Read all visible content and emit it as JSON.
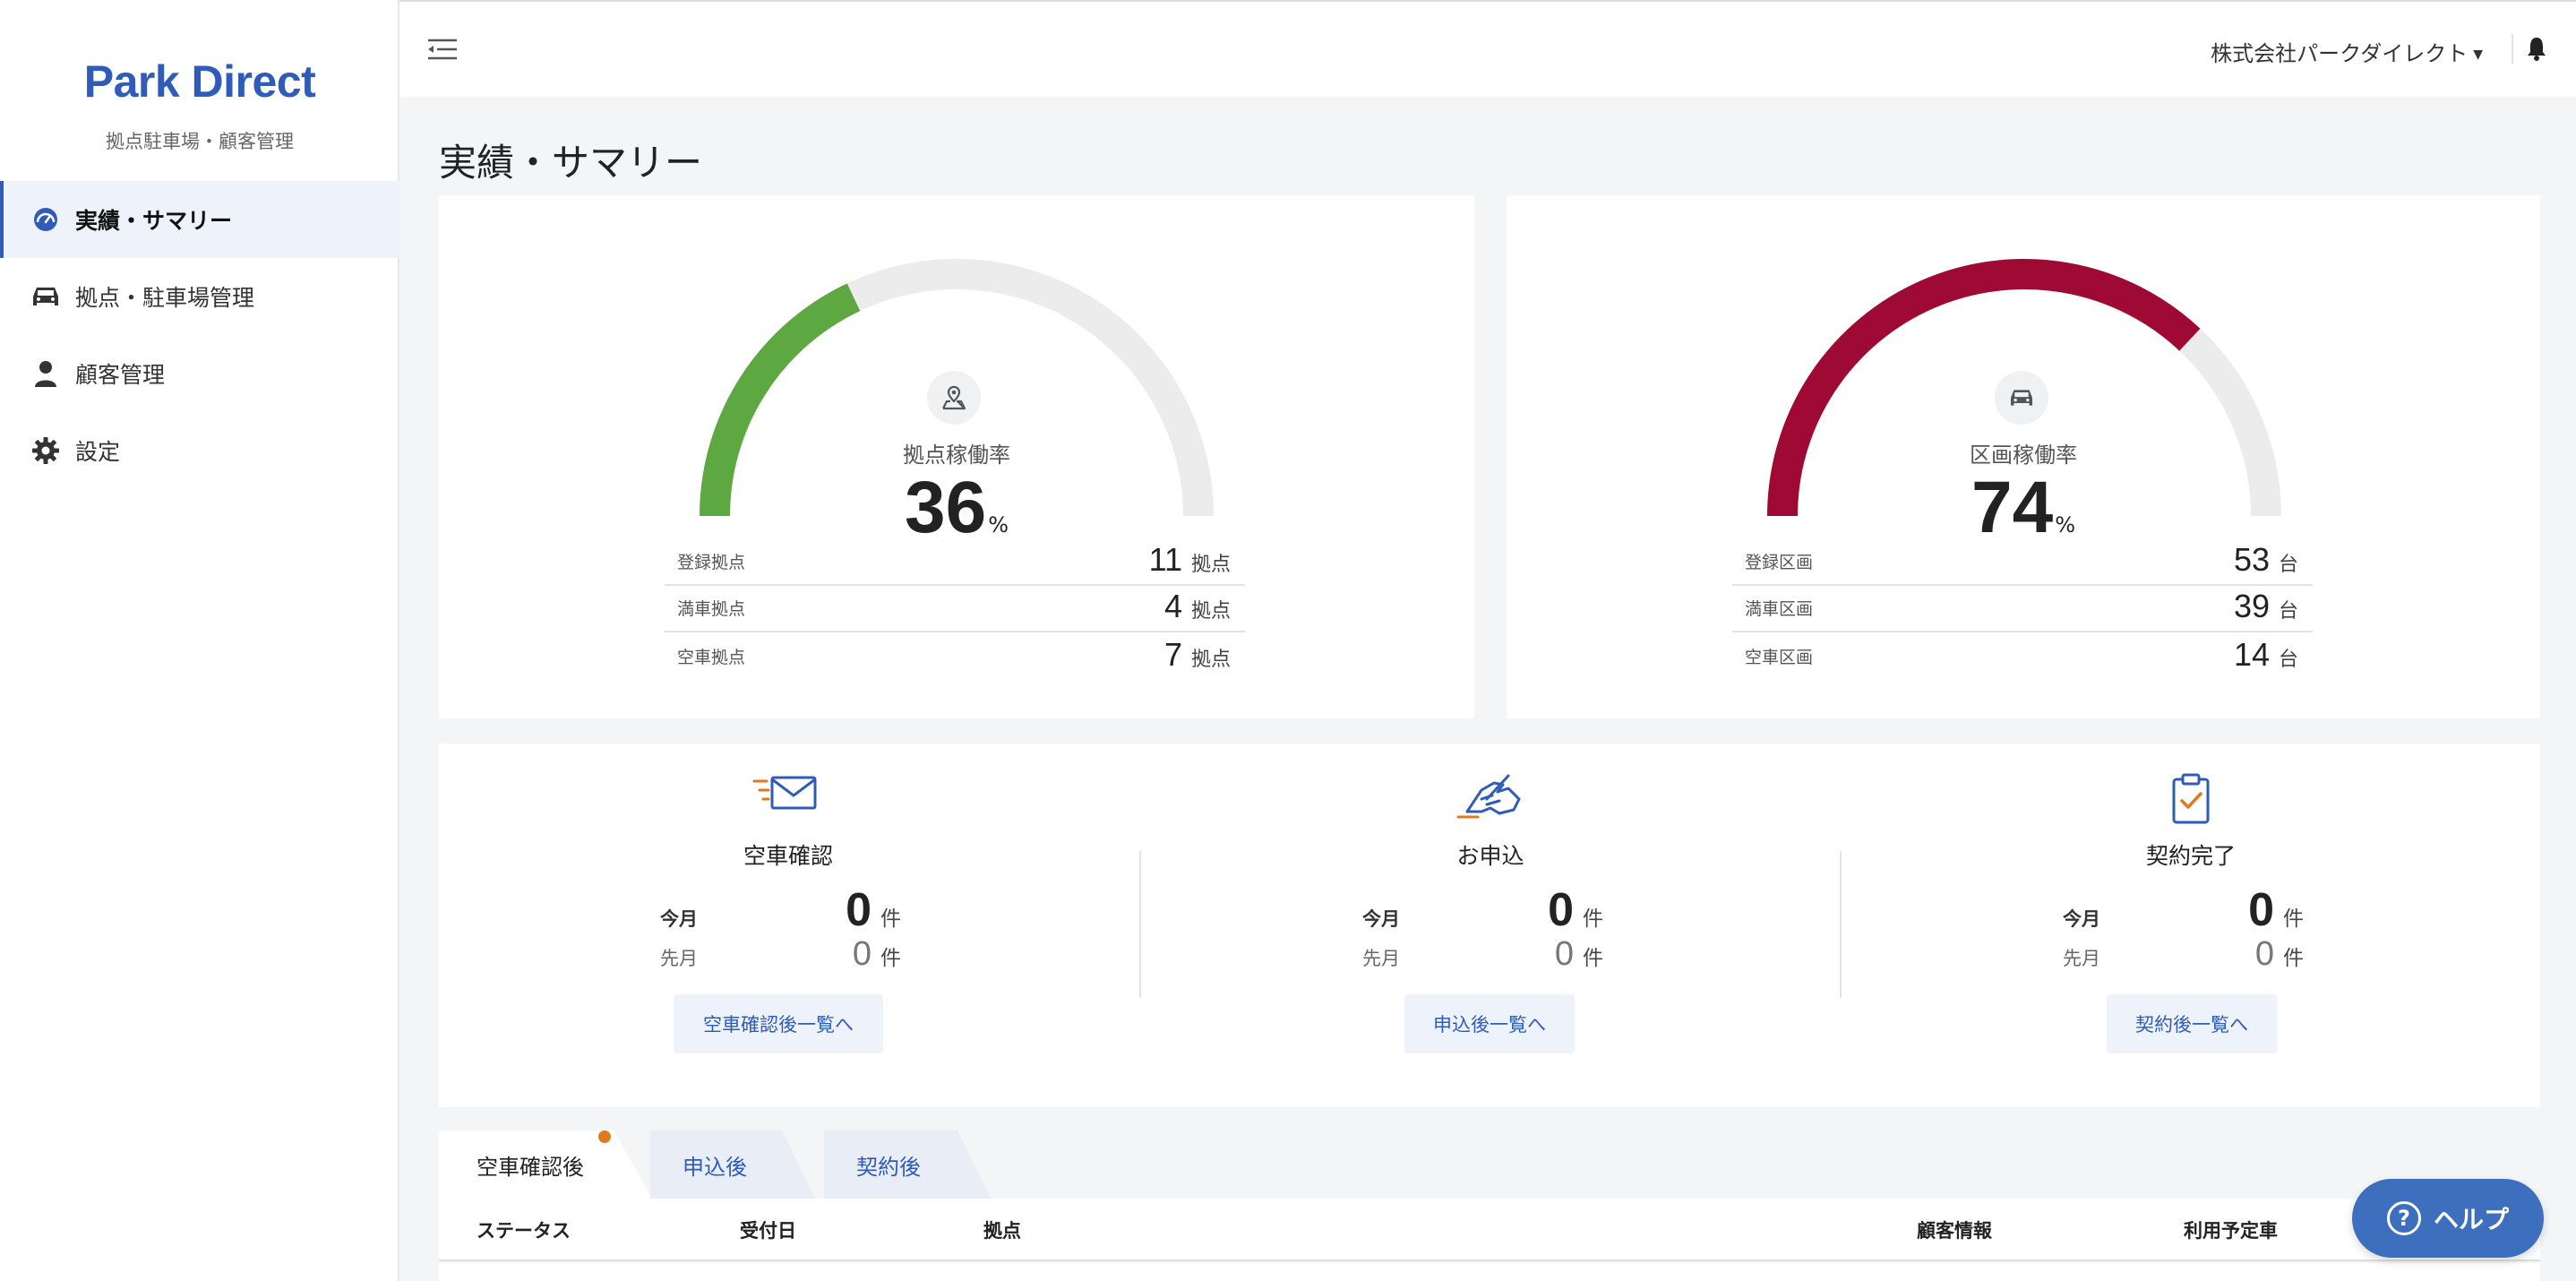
{
  "brand": {
    "name": "Park Direct",
    "subtitle": "拠点駐車場・顧客管理",
    "color": "#2f5cb8"
  },
  "sidebar": {
    "items": [
      {
        "label": "実績・サマリー",
        "icon": "dashboard-icon",
        "active": true
      },
      {
        "label": "拠点・駐車場管理",
        "icon": "car-icon",
        "active": false
      },
      {
        "label": "顧客管理",
        "icon": "user-icon",
        "active": false
      },
      {
        "label": "設定",
        "icon": "gear-icon",
        "active": false
      }
    ]
  },
  "header": {
    "company": "株式会社パークダイレクト",
    "bell_icon": "bell-icon",
    "menu_icon": "menu-collapse-icon"
  },
  "page": {
    "title": "実績・サマリー"
  },
  "gauges": [
    {
      "label": "拠点稼働率",
      "value": "36",
      "unit": "%",
      "fraction": 0.36,
      "color": "#5ea841",
      "icon": "map-pin-icon",
      "rows": [
        {
          "label": "登録拠点",
          "value": "11",
          "unit": "拠点"
        },
        {
          "label": "満車拠点",
          "value": "4",
          "unit": "拠点"
        },
        {
          "label": "空車拠点",
          "value": "7",
          "unit": "拠点"
        }
      ]
    },
    {
      "label": "区画稼働率",
      "value": "74",
      "unit": "%",
      "fraction": 0.74,
      "color": "#9e0a33",
      "icon": "car-icon",
      "rows": [
        {
          "label": "登録区画",
          "value": "53",
          "unit": "台"
        },
        {
          "label": "満車区画",
          "value": "39",
          "unit": "台"
        },
        {
          "label": "空車区画",
          "value": "14",
          "unit": "台"
        }
      ]
    }
  ],
  "summary": [
    {
      "title": "空車確認",
      "icon": "mail-icon",
      "this_month_label": "今月",
      "this_month": "0",
      "last_month_label": "先月",
      "last_month": "0",
      "unit": "件",
      "button": "空車確認後一覧へ"
    },
    {
      "title": "お申込",
      "icon": "handshake-icon",
      "this_month_label": "今月",
      "this_month": "0",
      "last_month_label": "先月",
      "last_month": "0",
      "unit": "件",
      "button": "申込後一覧へ"
    },
    {
      "title": "契約完了",
      "icon": "clipboard-check-icon",
      "this_month_label": "今月",
      "this_month": "0",
      "last_month_label": "先月",
      "last_month": "0",
      "unit": "件",
      "button": "契約後一覧へ"
    }
  ],
  "tabs": [
    {
      "label": "空車確認後",
      "active": true
    },
    {
      "label": "申込後",
      "active": false
    },
    {
      "label": "契約後",
      "active": false
    }
  ],
  "table": {
    "columns": [
      "ステータス",
      "受付日",
      "拠点",
      "顧客情報",
      "利用予定車"
    ]
  },
  "help": {
    "label": "ヘルプ"
  }
}
